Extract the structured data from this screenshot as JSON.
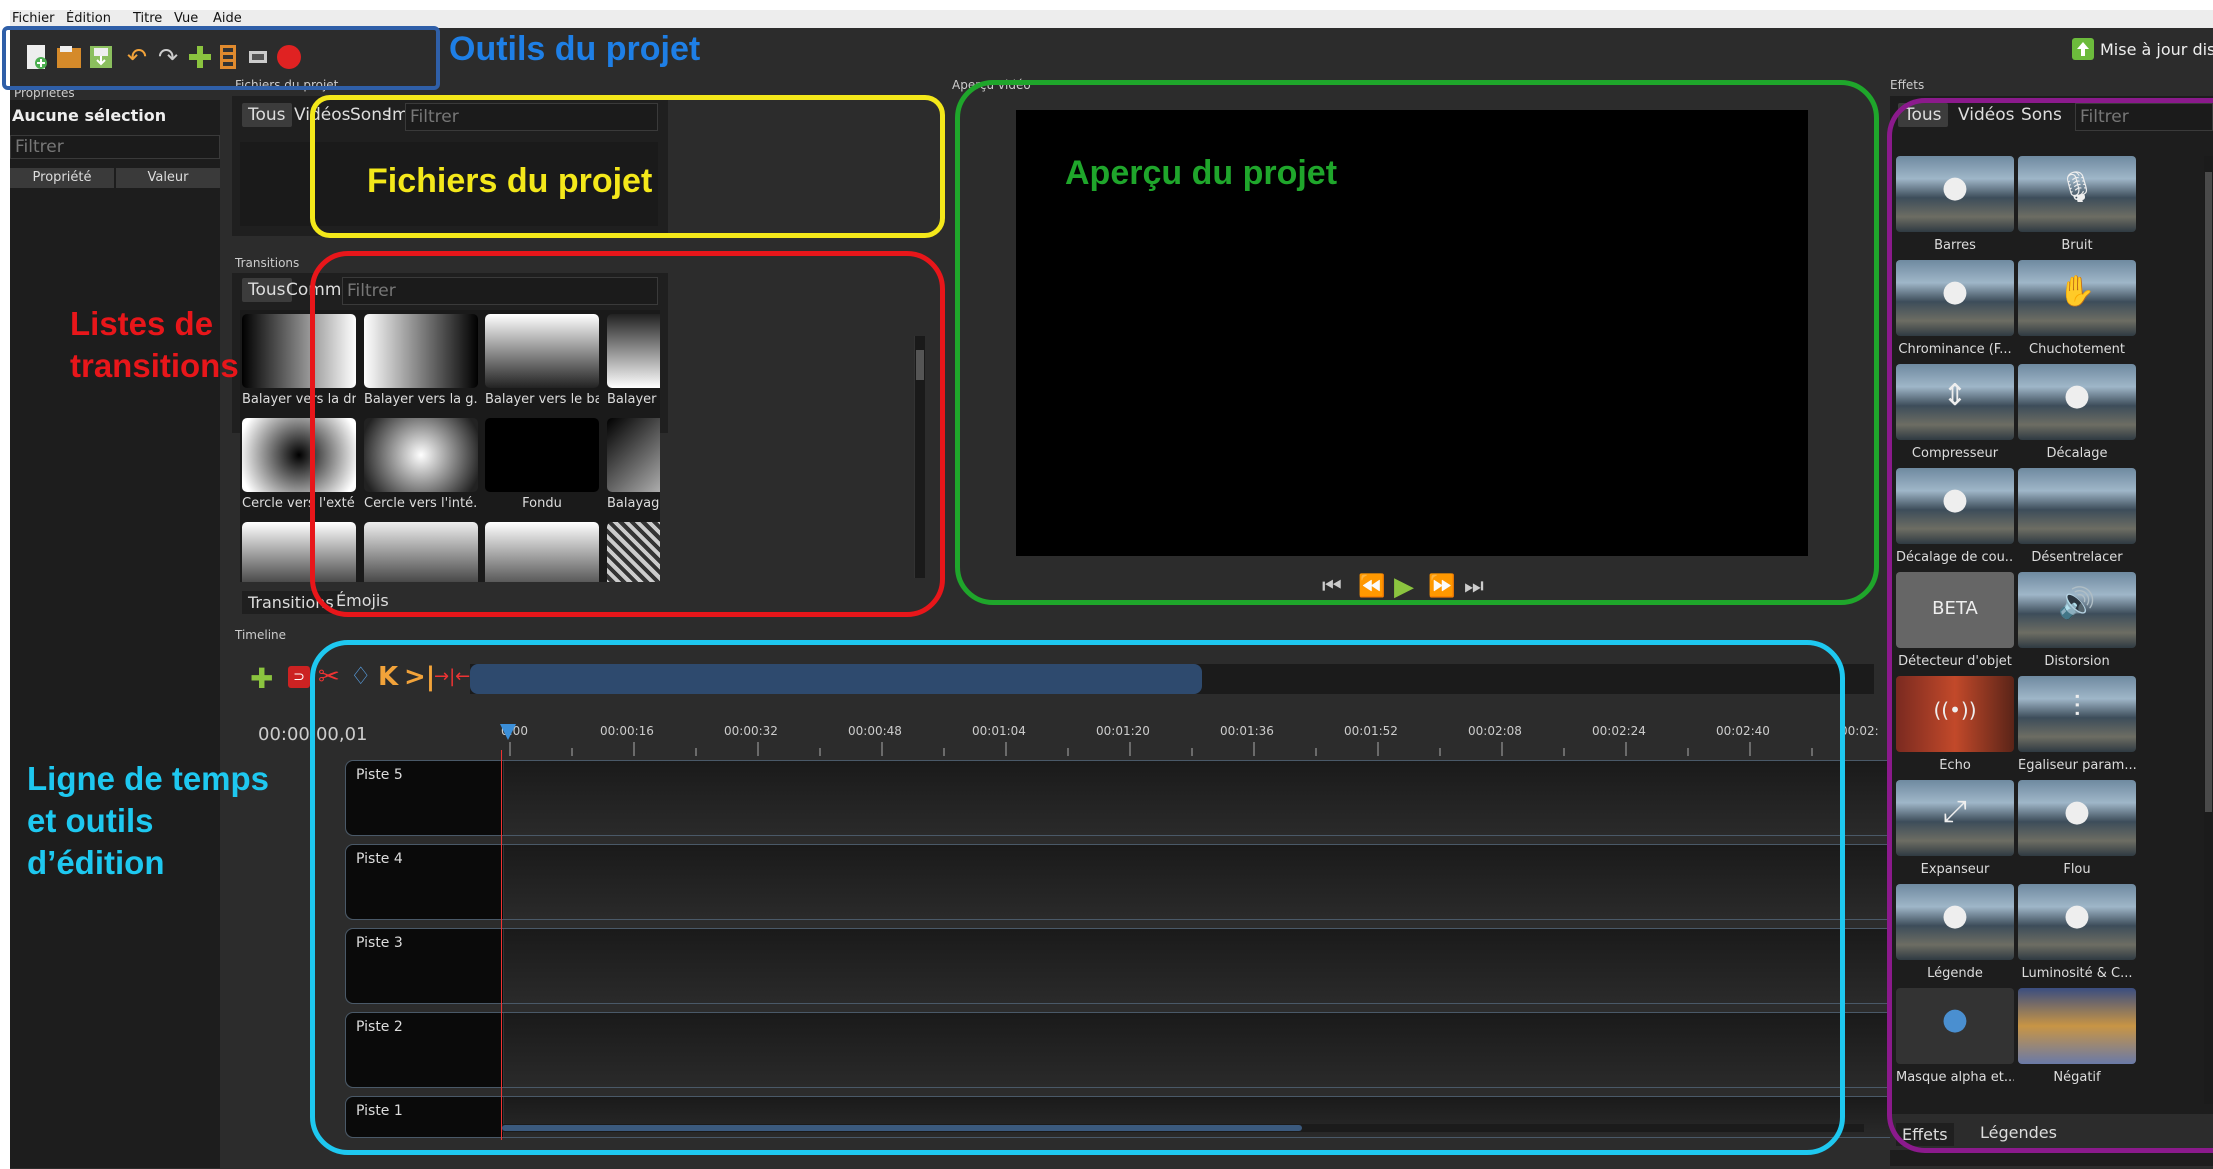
{
  "menu": [
    "Fichier",
    "Édition",
    "Titre",
    "Vue",
    "Aide"
  ],
  "toolbar": {
    "update_label": "Mise à jour disponible",
    "icons": [
      "new-project-icon",
      "open-project-icon",
      "save-project-icon",
      "undo-icon",
      "redo-icon",
      "import-files-icon",
      "choose-profile-icon",
      "fullscreen-icon",
      "export-video-icon"
    ]
  },
  "properties": {
    "dock_title": "Propriétés",
    "no_selection": "Aucune sélection",
    "filter_placeholder": "Filtrer",
    "col_property": "Propriété",
    "col_value": "Valeur"
  },
  "project_files": {
    "dock_title": "Fichiers du projet",
    "tabs": [
      "Tous",
      "Vidéos",
      "Sons",
      "Image"
    ],
    "filter_placeholder": "Filtrer"
  },
  "transitions": {
    "dock_title": "Transitions",
    "tabs": [
      "Tous",
      "Commun"
    ],
    "filter_placeholder": "Filtrer",
    "items": [
      "Balayer vers la dr...",
      "Balayer vers la g...",
      "Balayer vers le bas",
      "Balayer vers le h...",
      "Cercle vers l'exté...",
      "Cercle vers l'inté...",
      "Fondu",
      "Balayage diagon..."
    ],
    "bottom_tabs": [
      "Transitions",
      "Émojis"
    ]
  },
  "preview": {
    "dock_title": "Aperçu vidéo"
  },
  "timeline": {
    "dock_title": "Timeline",
    "timecode": "00:00:00,01",
    "ruler": [
      "0:00",
      "00:00:16",
      "00:00:32",
      "00:00:48",
      "00:01:04",
      "00:01:20",
      "00:01:36",
      "00:01:52",
      "00:02:08",
      "00:02:24",
      "00:02:40",
      "00:02:"
    ],
    "tracks": [
      "Piste 5",
      "Piste 4",
      "Piste 3",
      "Piste 2",
      "Piste 1"
    ]
  },
  "effects": {
    "dock_title": "Effets",
    "tabs": [
      "Tous",
      "Vidéos",
      "Sons"
    ],
    "filter_placeholder": "Filtrer",
    "items": [
      "Barres",
      "Bruit",
      "Chrominance (F...",
      "Chuchotement",
      "Compresseur",
      "Décalage",
      "Décalage de cou...",
      "Désentrelacer",
      "Détecteur d'objet",
      "Distorsion",
      "Écho",
      "Égaliseur param...",
      "Expanseur",
      "Flou",
      "Légende",
      "Luminosité & C...",
      "Masque alpha et...",
      "Négatif"
    ],
    "bottom_tabs": [
      "Effets",
      "Légendes"
    ]
  },
  "annotations": {
    "toolbar": "Outils du projet",
    "files": "Fichiers du projet",
    "transitions_line1": "Listes de",
    "transitions_line2": "transitions",
    "preview": "Aperçu du projet",
    "timeline_line1": "Ligne de temps",
    "timeline_line2": "et outils",
    "timeline_line3": "d’édition"
  },
  "colors": {
    "toolbar_box": "#2f5fa8",
    "files_box": "#f4e81a",
    "transitions_box": "#e8161a",
    "preview_box": "#1fa62b",
    "timeline_box": "#1ec8f0",
    "effects_box": "#8b1a8c",
    "toolbar_text": "#1e7fe6",
    "files_text": "#f4e81a",
    "transitions_text": "#e8161a",
    "preview_text": "#1fa62b",
    "timeline_text": "#1ec8f0"
  }
}
